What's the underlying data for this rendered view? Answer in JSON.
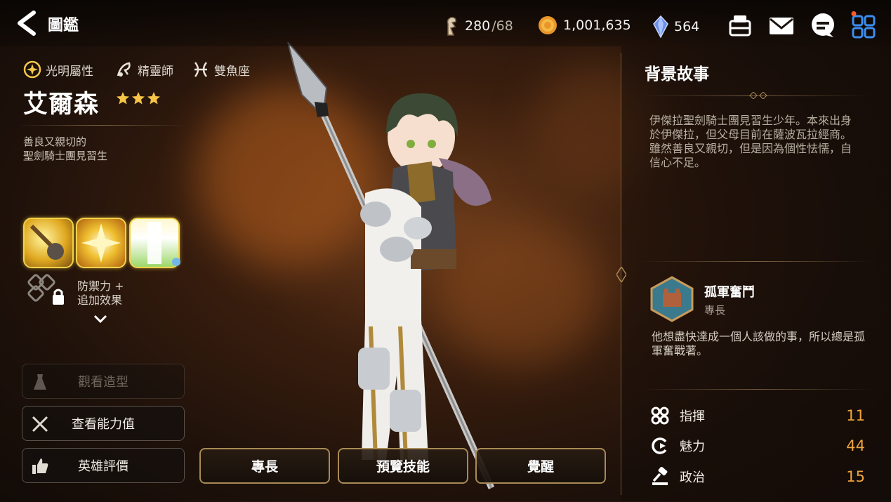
{
  "header": {
    "title": "圖鑑",
    "resources": [
      {
        "icon": "stamina-icon",
        "value": "280",
        "max": "/68"
      },
      {
        "icon": "gold-coin-icon",
        "value": "1,001,635"
      },
      {
        "icon": "crystal-icon",
        "value": "564"
      }
    ],
    "icons": [
      "guild-icon",
      "mail-icon",
      "chat-icon",
      "menu-grid-icon"
    ]
  },
  "hero": {
    "attributes": [
      {
        "icon": "light-attribute-icon",
        "label": "光明屬性"
      },
      {
        "icon": "spirit-mage-class-icon",
        "label": "精靈師"
      },
      {
        "icon": "pisces-icon",
        "label": "雙魚座"
      }
    ],
    "name": "艾爾森",
    "stars": 3,
    "subtitle_line1": "善良又親切的",
    "subtitle_line2": "聖劍騎士團見習生",
    "extra_line1": "防禦力 +",
    "extra_line2": "追加效果"
  },
  "left_buttons": [
    {
      "label": "觀看造型",
      "enabled": false
    },
    {
      "label": "查看能力值",
      "enabled": true
    },
    {
      "label": "英雄評價",
      "enabled": true
    }
  ],
  "center_buttons": [
    "專長",
    "預覽技能",
    "覺醒"
  ],
  "story": {
    "title": "背景故事",
    "text": "伊傑拉聖劍騎士團見習生少年。本來出身於伊傑拉，但父母目前在薩波瓦拉經商。雖然善良又親切，但是因為個性怯懦，自信心不足。"
  },
  "specialty": {
    "name": "孤軍奮鬥",
    "type": "專長",
    "description": "他想盡快達成一個人該做的事，所以總是孤軍奮戰著。"
  },
  "stats": [
    {
      "icon": "command-icon",
      "label": "指揮",
      "value": "11"
    },
    {
      "icon": "charm-icon",
      "label": "魅力",
      "value": "44"
    },
    {
      "icon": "politics-icon",
      "label": "政治",
      "value": "15"
    }
  ],
  "colors": {
    "accent_gold": "#a88a55",
    "stat_value": "#f0a43c",
    "skill_border": "#f1d24a"
  }
}
